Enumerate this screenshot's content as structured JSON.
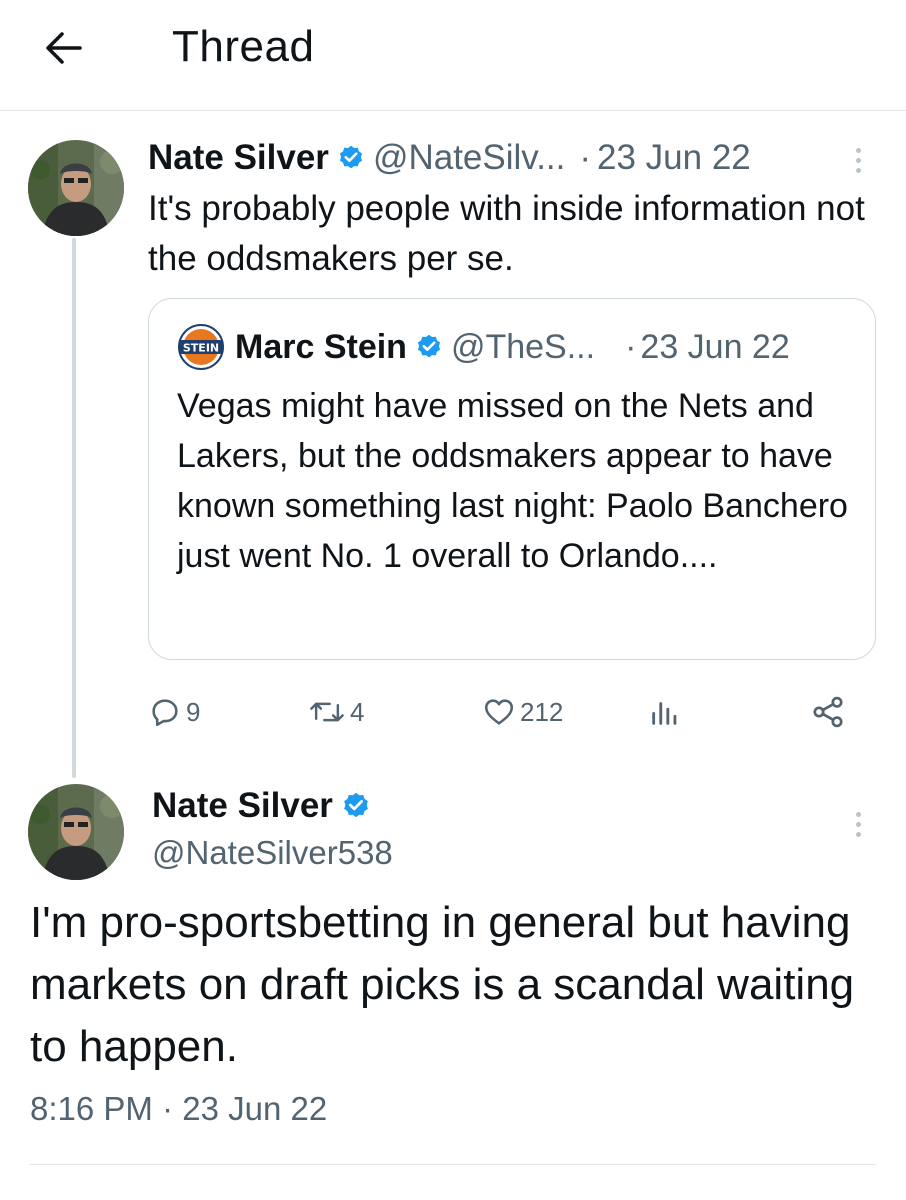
{
  "header": {
    "title": "Thread",
    "back_icon": "arrow-left-icon"
  },
  "tweet1": {
    "name": "Nate Silver",
    "handle": "@NateSilv...",
    "dot": "·",
    "date": "23 Jun 22",
    "text": "It's probably people with inside information not the oddsmakers per se.",
    "quote": {
      "logo_text": "STEIN",
      "name": "Marc Stein",
      "handle": "@TheS...",
      "dot": "·",
      "date": "23 Jun 22",
      "text": "Vegas might have missed on the Nets and Lakers, but the oddsmakers appear to have known something last night: Paolo Banchero just went No. 1 overall to Orlando...."
    },
    "actions": {
      "replies": "9",
      "retweets": "4",
      "likes": "212"
    }
  },
  "tweet2": {
    "name": "Nate Silver",
    "handle": "@NateSilver538",
    "text": "I'm pro-sportsbetting in general but having markets on draft picks is a scandal waiting to happen.",
    "time": "8:16 PM",
    "dot": "·",
    "date": "23 Jun 22"
  },
  "colors": {
    "verified": "#1d9bf0",
    "secondary_text": "#536471",
    "primary_text": "#0f1419",
    "border": "#cfd9de"
  }
}
